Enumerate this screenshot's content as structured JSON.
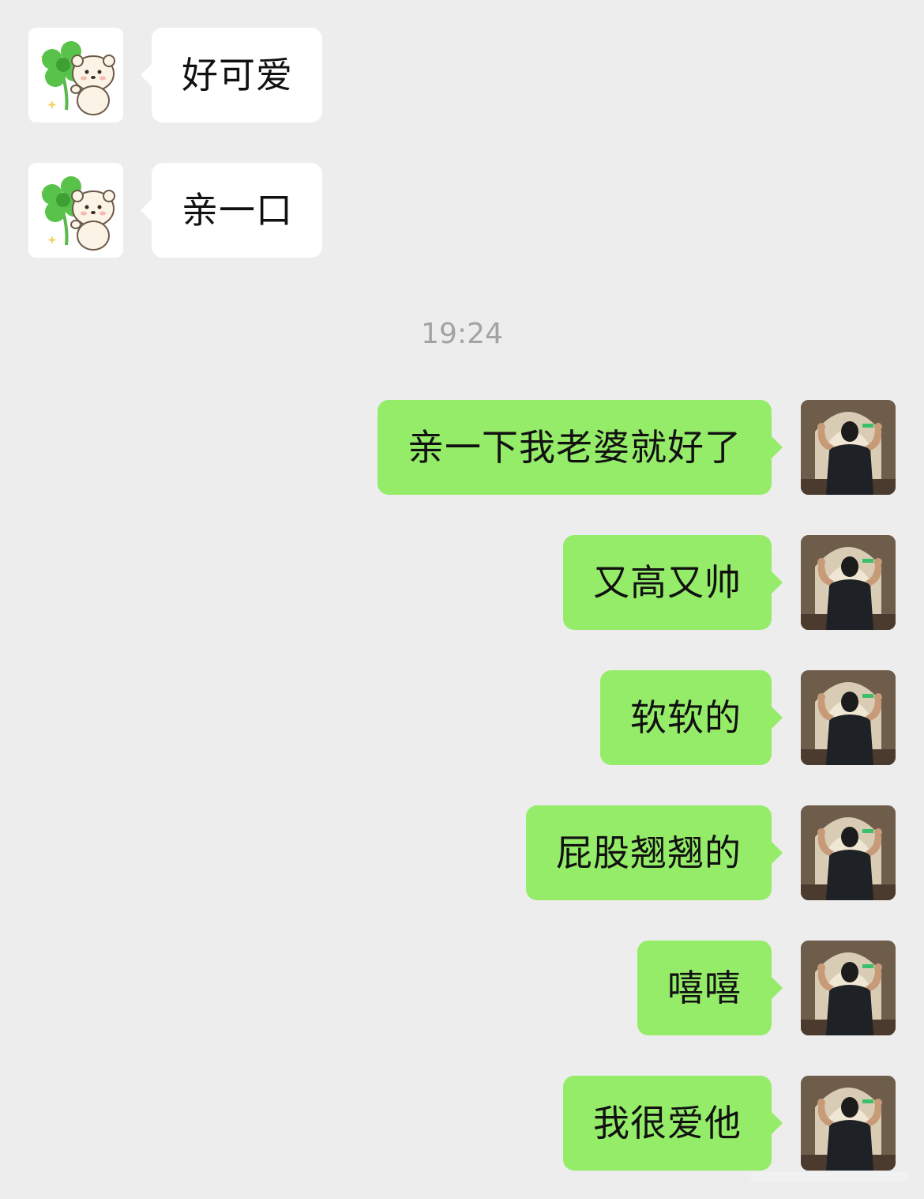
{
  "conversation": {
    "incoming": [
      {
        "text": "好可爱",
        "avatar_icon": "clover-bear-sticker-icon"
      },
      {
        "text": "亲一口",
        "avatar_icon": "clover-bear-sticker-icon"
      }
    ],
    "timestamp": "19:24",
    "outgoing": [
      {
        "text": "亲一下我老婆就好了",
        "avatar_icon": "man-flexing-photo-avatar"
      },
      {
        "text": "又高又帅",
        "avatar_icon": "man-flexing-photo-avatar"
      },
      {
        "text": "软软的",
        "avatar_icon": "man-flexing-photo-avatar"
      },
      {
        "text": "屁股翘翘的",
        "avatar_icon": "man-flexing-photo-avatar"
      },
      {
        "text": "嘻嘻",
        "avatar_icon": "man-flexing-photo-avatar"
      },
      {
        "text": "我很爱他",
        "avatar_icon": "man-flexing-photo-avatar"
      }
    ]
  },
  "colors": {
    "background": "#ededed",
    "incoming_bubble": "#ffffff",
    "outgoing_bubble": "#95ec69",
    "timestamp_text": "#a3a3a3"
  }
}
